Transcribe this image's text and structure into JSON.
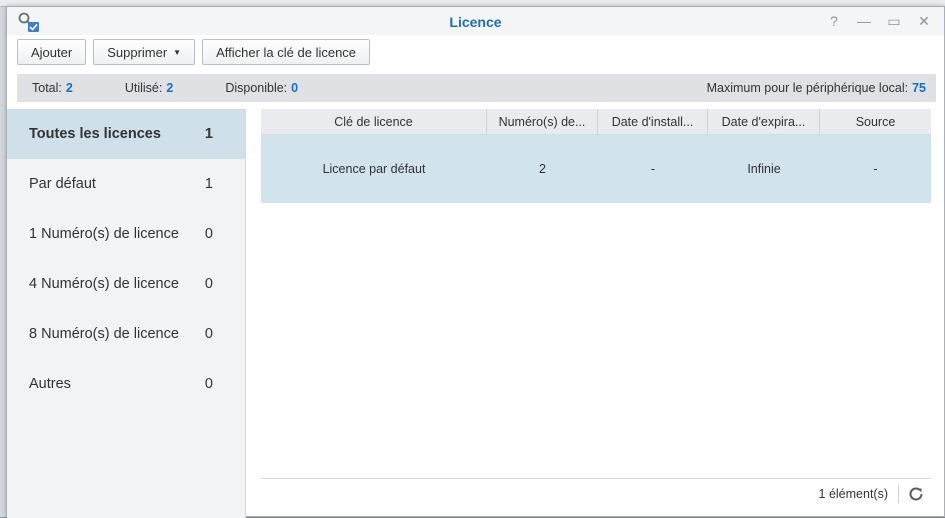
{
  "window": {
    "title": "Licence",
    "controls": {
      "help": "?",
      "minimize": "—",
      "maximize": "▭",
      "close": "✕"
    }
  },
  "toolbar": {
    "add_label": "Ajouter",
    "delete_label": "Supprimer",
    "show_key_label": "Afficher la clé de licence"
  },
  "stats": {
    "total_label": "Total:",
    "total_value": "2",
    "used_label": "Utilisé:",
    "used_value": "2",
    "available_label": "Disponible:",
    "available_value": "0",
    "max_label": "Maximum pour le périphérique local:",
    "max_value": "75"
  },
  "sidebar": {
    "items": [
      {
        "label": "Toutes les licences",
        "count": "1"
      },
      {
        "label": "Par défaut",
        "count": "1"
      },
      {
        "label": "1 Numéro(s) de licence",
        "count": "0"
      },
      {
        "label": "4 Numéro(s) de licence",
        "count": "0"
      },
      {
        "label": "8 Numéro(s) de licence",
        "count": "0"
      },
      {
        "label": "Autres",
        "count": "0"
      }
    ]
  },
  "table": {
    "columns": [
      "Clé de licence",
      "Numéro(s) de...",
      "Date d'install...",
      "Date d'expira...",
      "Source"
    ],
    "rows": [
      [
        "Licence par défaut",
        "2",
        "-",
        "Infinie",
        "-"
      ]
    ]
  },
  "footer": {
    "count_text": "1 élément(s)"
  },
  "colors": {
    "accent": "#1a6fbd",
    "selected_row": "#d1e3ec",
    "sidebar_active": "#cfe0ea"
  },
  "icons": {
    "app": "license-key-icon",
    "refresh": "refresh-icon"
  }
}
